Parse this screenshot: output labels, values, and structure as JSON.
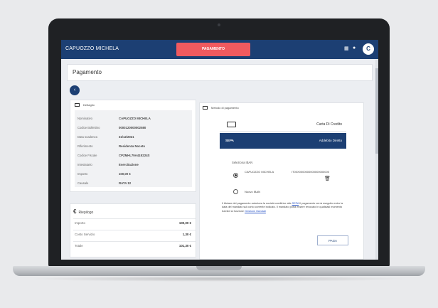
{
  "app": {
    "user_name": "CAPUOZZO MICHELA",
    "alert_button": "PAGAMENTO",
    "avatar_initial": "C"
  },
  "page": {
    "title": "Pagamento"
  },
  "details": {
    "heading": "Dettaglio",
    "rows": [
      {
        "label": "Nominativo",
        "value": "CAPUOZZO MICHELA"
      },
      {
        "label": "Codice Bollettino",
        "value": "0000120000002580"
      },
      {
        "label": "Data scadenza",
        "value": "31/12/2021"
      },
      {
        "label": "Riferimento",
        "value": "Residenza Noceto"
      },
      {
        "label": "Codice Fiscale",
        "value": "CPZMHL79A41E224S"
      },
      {
        "label": "Intestatario",
        "value": "Esercitazione"
      },
      {
        "label": "Importo",
        "value": "100,00 €"
      },
      {
        "label": "Causale",
        "value": "RATA 12"
      }
    ]
  },
  "summary": {
    "heading": "Riepilogo",
    "rows": [
      {
        "label": "Importo",
        "value": "100,00 €"
      },
      {
        "label": "Costo Servizio",
        "value": "1,30 €"
      },
      {
        "label": "Totale",
        "value": "101,30 €"
      }
    ]
  },
  "payment": {
    "heading": "Metodo di pagamento",
    "credit_card_label": "Carta Di Credito",
    "direct_debit_logo": "SEPA",
    "direct_debit_label": "Addebito Diretto",
    "options_title": "Seleziona IBAN",
    "option_1_label": "CAPUOZZO MICHELA",
    "option_1_value": "IT00X0000000000000000000",
    "option_2_label": "Nuovo IBAN",
    "note_pre": "Il titolare del pagamento autorizza la società creditrice alla",
    "note_link_1": "SEPA",
    "note_mid": "Il pagamento verrà eseguito entro la data del mandato sul conto corrente indicato. Il mandato potrà essere revocato in qualsiasi momento tramite la funzione",
    "note_link_2": "Gestione Mandati",
    "pay_button": "PAGA"
  },
  "colors": {
    "brand": "#1c3f73",
    "alert": "#f05a5f"
  }
}
